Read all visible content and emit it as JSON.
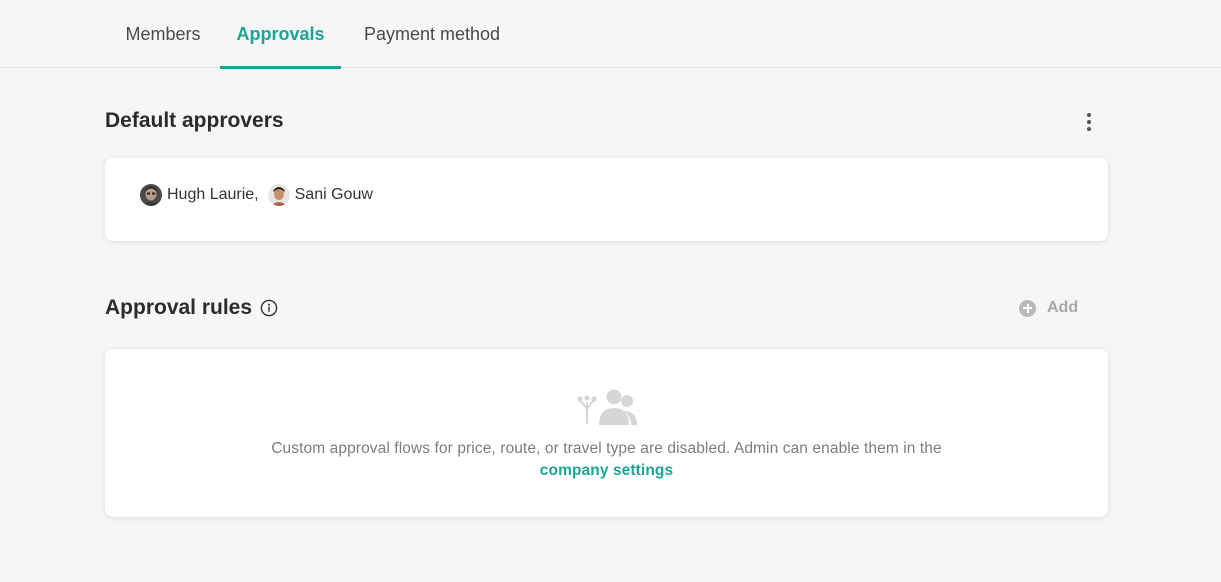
{
  "tabs": [
    {
      "label": "Members",
      "active": false
    },
    {
      "label": "Approvals",
      "active": true
    },
    {
      "label": "Payment method",
      "active": false
    }
  ],
  "default_approvers": {
    "title": "Default approvers",
    "menu_icon": "kebab-menu-icon",
    "approvers": [
      {
        "name": "Hugh Laurie",
        "separator": ","
      },
      {
        "name": "Sani Gouw",
        "separator": ""
      }
    ]
  },
  "approval_rules": {
    "title": "Approval rules",
    "info_icon": "info-icon",
    "add_label": "Add",
    "empty_icon": "approval-flow-people-icon",
    "empty_text": "Custom approval flows for price, route, or travel type are disabled. Admin can enable them in the",
    "empty_link": "company settings"
  },
  "colors": {
    "accent": "#1aa596",
    "background": "#f6f6f6",
    "muted": "#a7a7a7"
  }
}
